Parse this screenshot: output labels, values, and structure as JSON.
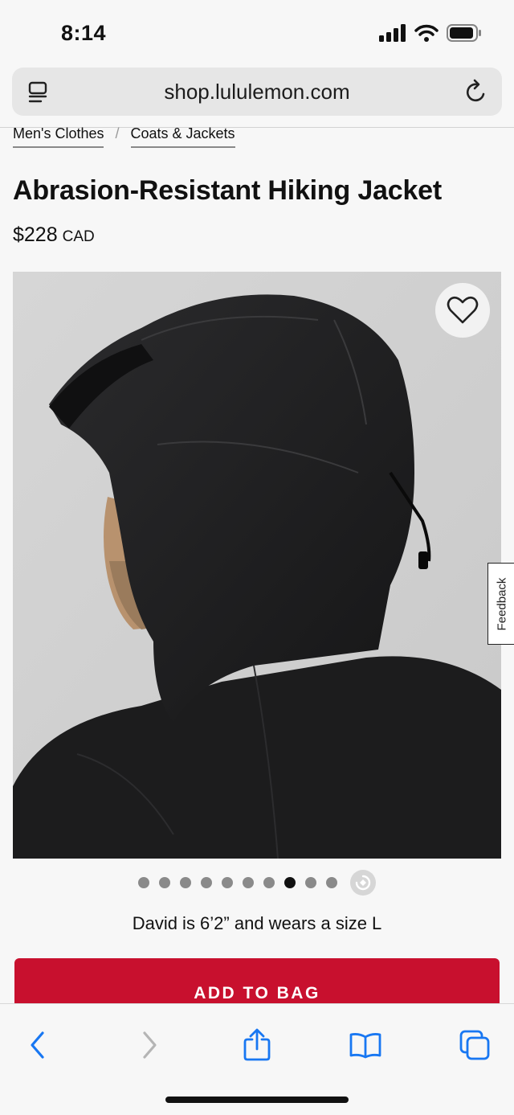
{
  "status_bar": {
    "time": "8:14"
  },
  "browser": {
    "url": "shop.lululemon.com",
    "icons": {
      "reader": "reader-icon",
      "reload": "reload-icon"
    }
  },
  "breadcrumb": {
    "items": [
      "Men's Clothes",
      "Coats & Jackets"
    ],
    "separator": "/"
  },
  "product": {
    "title": "Abrasion-Resistant Hiking Jacket",
    "price": "$228",
    "currency": "CAD",
    "model_info": "David is 6’2” and wears a size L",
    "image_count": 10,
    "active_image_index": 7
  },
  "feedback": {
    "label": "Feedback"
  },
  "cta": {
    "add_to_bag": "ADD TO BAG"
  },
  "colors": {
    "brand_red": "#c8102e",
    "safari_blue": "#1877f2"
  },
  "toolbar": {
    "icons": [
      "back-icon",
      "forward-icon",
      "share-icon",
      "bookmarks-icon",
      "tabs-icon"
    ]
  }
}
